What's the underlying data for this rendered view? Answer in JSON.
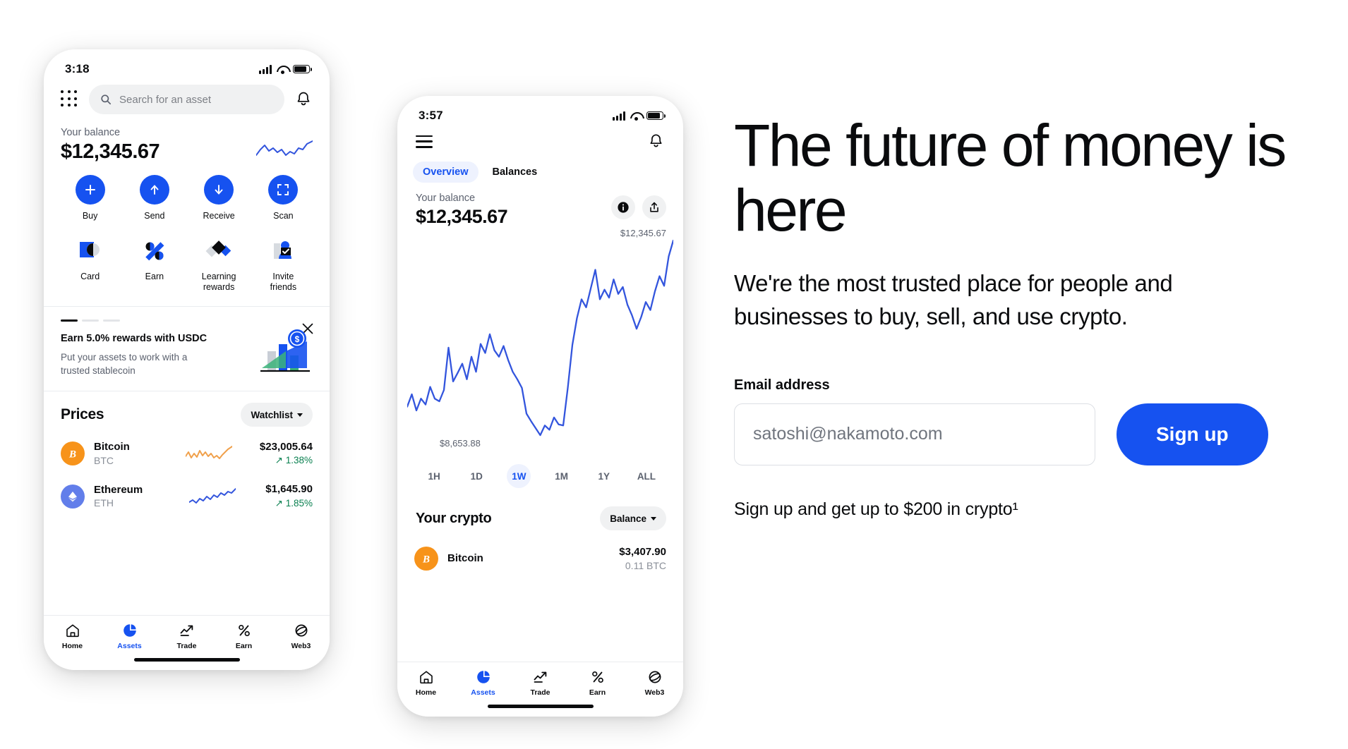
{
  "phone_one": {
    "status": {
      "time": "3:18"
    },
    "search": {
      "placeholder": "Search for an asset"
    },
    "balance": {
      "label": "Your balance",
      "amount": "$12,345.67"
    },
    "actions": [
      {
        "label": "Buy",
        "icon": "plus-icon"
      },
      {
        "label": "Send",
        "icon": "arrow-up-icon"
      },
      {
        "label": "Receive",
        "icon": "arrow-down-icon"
      },
      {
        "label": "Scan",
        "icon": "scan-icon"
      }
    ],
    "features": [
      {
        "label": "Card",
        "icon": "card-art-icon"
      },
      {
        "label": "Earn",
        "icon": "percent-art-icon"
      },
      {
        "label": "Learning rewards",
        "icon": "diamonds-art-icon"
      },
      {
        "label": "Invite friends",
        "icon": "person-art-icon"
      }
    ],
    "promo": {
      "title": "Earn 5.0% rewards with USDC",
      "subtitle": "Put your assets to work with a trusted stablecoin",
      "close_icon": "close-icon"
    },
    "prices": {
      "title": "Prices",
      "filter_label": "Watchlist",
      "rows": [
        {
          "name": "Bitcoin",
          "symbol": "BTC",
          "price": "$23,005.64",
          "change": "1.38%",
          "trend": "up"
        },
        {
          "name": "Ethereum",
          "symbol": "ETH",
          "price": "$1,645.90",
          "change": "1.85%",
          "trend": "up"
        }
      ]
    },
    "tabs": [
      {
        "label": "Home",
        "icon": "home-icon",
        "active": false
      },
      {
        "label": "Assets",
        "icon": "pie-chart-icon",
        "active": true
      },
      {
        "label": "Trade",
        "icon": "trend-arrow-icon",
        "active": false
      },
      {
        "label": "Earn",
        "icon": "percent-icon",
        "active": false
      },
      {
        "label": "Web3",
        "icon": "globe-icon",
        "active": false
      }
    ]
  },
  "phone_two": {
    "status": {
      "time": "3:57"
    },
    "menu_icon": "hamburger-icon",
    "bell_icon": "bell-icon",
    "segments": [
      {
        "label": "Overview",
        "active": true
      },
      {
        "label": "Balances",
        "active": false
      }
    ],
    "balance": {
      "label": "Your balance",
      "amount": "$12,345.67"
    },
    "header_buttons": [
      {
        "icon": "info-icon"
      },
      {
        "icon": "share-icon"
      }
    ],
    "chart_data": {
      "type": "line",
      "title": "Your balance",
      "high_label": "$12,345.67",
      "low_label": "$8,653.88",
      "ylim": [
        8653.88,
        12345.67
      ],
      "series": [
        {
          "name": "Portfolio balance",
          "values": [
            9250,
            9480,
            9180,
            9400,
            9290,
            9620,
            9400,
            9350,
            9560,
            10350,
            9720,
            9880,
            10050,
            9760,
            10180,
            9900,
            10420,
            10250,
            10600,
            10300,
            10180,
            10380,
            10120,
            9900,
            9760,
            9600,
            9120,
            8980,
            8850,
            8720,
            8900,
            8820,
            9050,
            8920,
            8900,
            9600,
            10400,
            10900,
            11250,
            11100,
            11450,
            11800,
            11250,
            11430,
            11280,
            11620,
            11350,
            11480,
            11150,
            10950,
            10700,
            10920,
            11200,
            11050,
            11400,
            11680,
            11500,
            12050,
            12345
          ]
        }
      ],
      "ranges": [
        {
          "label": "1H",
          "active": false
        },
        {
          "label": "1D",
          "active": false
        },
        {
          "label": "1W",
          "active": true
        },
        {
          "label": "1M",
          "active": false
        },
        {
          "label": "1Y",
          "active": false
        },
        {
          "label": "ALL",
          "active": false
        }
      ],
      "line_color": "#3355dd",
      "grid": false,
      "legend": "none"
    },
    "your_crypto": {
      "title": "Your crypto",
      "filter_label": "Balance",
      "rows": [
        {
          "name": "Bitcoin",
          "value": "$3,407.90",
          "amount": "0.11 BTC"
        }
      ]
    },
    "tabs": [
      {
        "label": "Home",
        "icon": "home-icon",
        "active": false
      },
      {
        "label": "Assets",
        "icon": "pie-chart-icon",
        "active": true
      },
      {
        "label": "Trade",
        "icon": "trend-arrow-icon",
        "active": false
      },
      {
        "label": "Earn",
        "icon": "percent-icon",
        "active": false
      },
      {
        "label": "Web3",
        "icon": "globe-icon",
        "active": false
      }
    ]
  },
  "marketing": {
    "headline": "The future of money is here",
    "subhead": "We're the most trusted place for people and businesses to buy, sell, and use crypto.",
    "email_label": "Email address",
    "email_placeholder": "satoshi@nakamoto.com",
    "email_value": "",
    "signup_label": "Sign up",
    "fineprint": "Sign up and get up to $200 in crypto¹"
  },
  "colors": {
    "brand_blue": "#1652f0",
    "chart_blue": "#3355dd",
    "positive_green": "#0a8050",
    "btc_orange": "#f7931a",
    "eth_purple": "#627eea",
    "text_primary": "#0a0b0d",
    "text_secondary": "#5b616e"
  }
}
